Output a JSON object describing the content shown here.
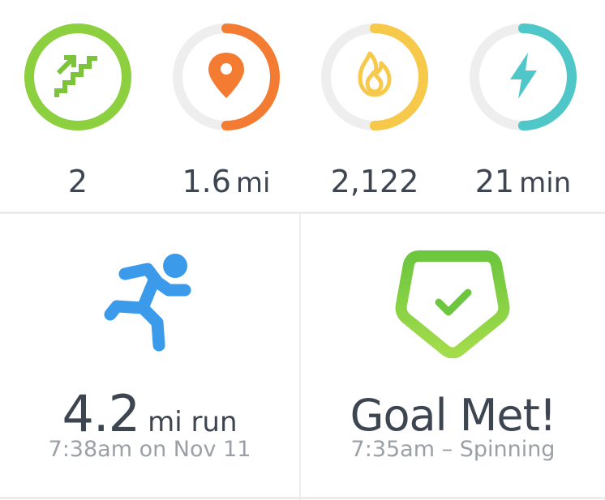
{
  "stats": [
    {
      "id": "floors",
      "value": "2",
      "unit": "",
      "icon": "stairs-icon",
      "color": "#8ccf3f",
      "progress": 1.0
    },
    {
      "id": "distance",
      "value": "1.6",
      "unit": "mi",
      "icon": "location-pin-icon",
      "color": "#f47b32",
      "progress": 0.5
    },
    {
      "id": "calories",
      "value": "2,122",
      "unit": "",
      "icon": "flame-icon",
      "color": "#f6c94a",
      "progress": 0.5
    },
    {
      "id": "active_minutes",
      "value": "21",
      "unit": "min",
      "icon": "lightning-icon",
      "color": "#4fc6c8",
      "progress": 0.5
    }
  ],
  "exercise": {
    "value": "4.2",
    "label": "mi run",
    "subtitle": "7:38am on Nov 11",
    "icon": "runner-icon",
    "color": "#3b9bea"
  },
  "goal": {
    "title": "Goal Met!",
    "subtitle": "7:35am – Spinning",
    "icon": "goal-badge-icon",
    "color": "#7ed048"
  }
}
